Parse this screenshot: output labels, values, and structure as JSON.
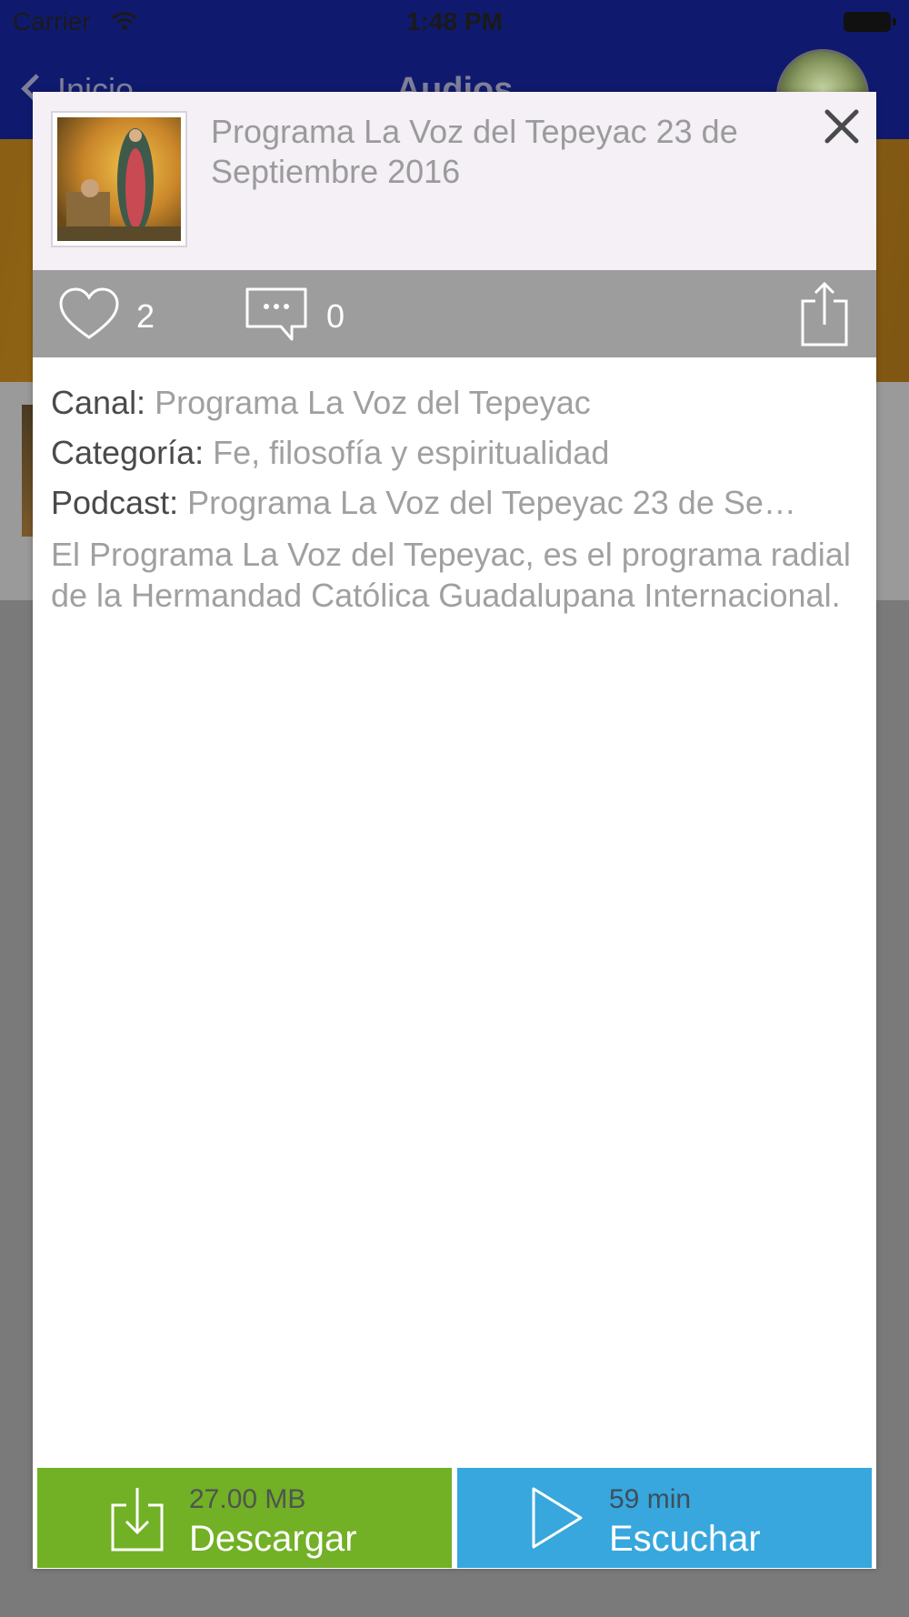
{
  "status_bar": {
    "carrier": "Carrier",
    "time": "1:48 PM"
  },
  "background": {
    "back_label": "Inicio",
    "title": "Audios"
  },
  "modal": {
    "title": "Programa La Voz del Tepeyac 23 de Septiembre 2016",
    "actions": {
      "likes": "2",
      "comments": "0"
    },
    "meta": {
      "channel_label": "Canal:",
      "channel_value": "Programa La Voz del Tepeyac",
      "category_label": "Categoría:",
      "category_value": "Fe, filosofía y espiritualidad",
      "podcast_label": "Podcast:",
      "podcast_value": "Programa La Voz del Tepeyac 23 de Se…"
    },
    "description": "El Programa La Voz del Tepeyac, es el programa radial de la Hermandad Católica Guadalupana Internacional.",
    "download": {
      "size": "27.00 MB",
      "label": "Descargar"
    },
    "listen": {
      "duration": "59 min",
      "label": "Escuchar"
    }
  },
  "colors": {
    "download_green": "#72b026",
    "listen_blue": "#37a7de",
    "action_bar_gray": "#9d9d9d",
    "header_bg": "#f4f0f6",
    "nav_blue": "#0f1a6e"
  },
  "icons": {
    "wifi": "wifi-icon",
    "battery": "battery-icon",
    "close": "close-icon",
    "like": "heart-icon",
    "comment": "comment-icon",
    "share": "share-icon",
    "download": "download-icon",
    "play": "play-icon"
  }
}
